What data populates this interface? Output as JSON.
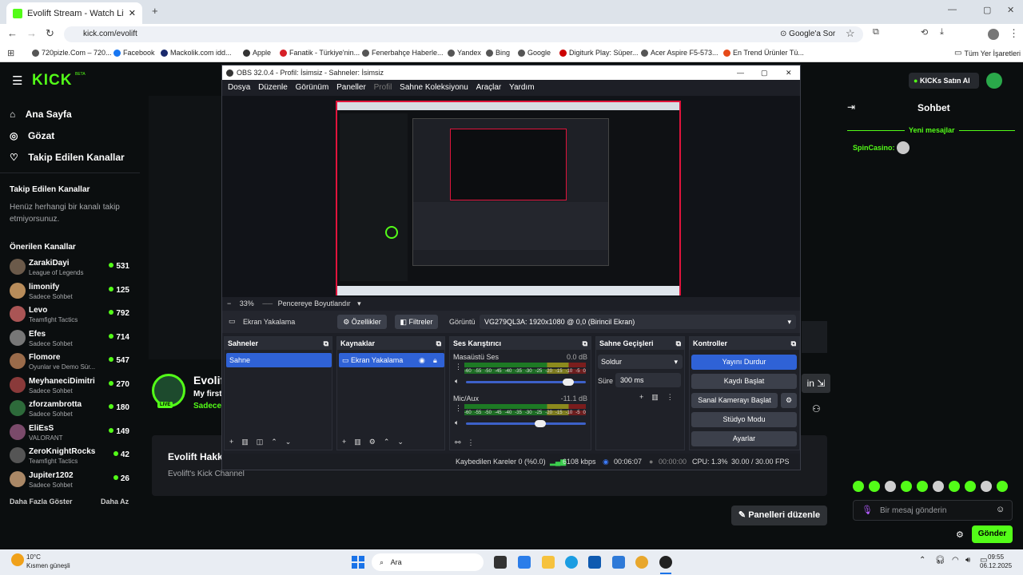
{
  "browser": {
    "tab_title": "Evolift Stream - Watch Live on K",
    "url": "kick.com/evolift",
    "google_btn": "Google'a Sor",
    "bookmarks": [
      "720pizle.Com – 720...",
      "Facebook",
      "Mackolik.com   idd...",
      "Apple",
      "Fanatik - Türkiye'nin...",
      "Fenerbahçe Haberle...",
      "Yandex",
      "Bing",
      "Google",
      "Digiturk Play: Süper...",
      "Acer Aspire F5-573...",
      "En Trend Ürünler Tü..."
    ],
    "all_bookmarks": "Tüm Yer İşaretleri"
  },
  "kick": {
    "logo": "KICK",
    "beta": "BETA",
    "nav": [
      "Ana Sayfa",
      "Gözat",
      "Takip Edilen Kanallar"
    ],
    "followed_title": "Takip Edilen Kanallar",
    "followed_empty": "Henüz herhangi bir kanalı takip etmiyorsunuz.",
    "recommended_title": "Önerilen Kanallar",
    "channels": [
      {
        "name": "ZarakiDayi",
        "game": "League of Legends",
        "viewers": "531"
      },
      {
        "name": "limonify",
        "game": "Sadece Sohbet",
        "viewers": "125"
      },
      {
        "name": "Levo",
        "game": "Teamfight Tactics",
        "viewers": "792"
      },
      {
        "name": "Efes",
        "game": "Sadece Sohbet",
        "viewers": "714"
      },
      {
        "name": "Flomore",
        "game": "Oyunlar ve Demo Sür...",
        "viewers": "547"
      },
      {
        "name": "MeyhaneciDimitri",
        "game": "Sadece Sohbet",
        "viewers": "270"
      },
      {
        "name": "zforzambrotta",
        "game": "Sadece Sohbet",
        "viewers": "180"
      },
      {
        "name": "EliEsS",
        "game": "VALORANT",
        "viewers": "149"
      },
      {
        "name": "ZeroKnightRocks",
        "game": "Teamfight Tactics",
        "viewers": "42"
      },
      {
        "name": "Jupiter1202",
        "game": "Sadece Sohbet",
        "viewers": "26"
      }
    ],
    "show_more": "Daha Fazla Göster",
    "show_less": "Daha Az",
    "kicks_btn": "KICKs Satın Al",
    "chat_title": "Sohbet",
    "new_messages": "Yeni mesajlar",
    "chat_user": "SpinCasino:",
    "streamer": "Evolift",
    "stream_title": "My first",
    "stream_game": "Sadece",
    "about_title": "Evolift Hakkı",
    "about_text": "Evolift's Kick Channel",
    "edit_panels": "Panelleri düzenle",
    "chat_placeholder": "Bir mesaj gönderin",
    "send": "Gönder"
  },
  "obs": {
    "title": "OBS 32.0.4 - Profil: İsimsiz - Sahneler: İsimsiz",
    "menu": [
      "Dosya",
      "Düzenle",
      "Görünüm",
      "Paneller",
      "Profil",
      "Sahne Koleksiyonu",
      "Araçlar",
      "Yardım"
    ],
    "zoom": "33%",
    "fit": "Pencereye Boyutlandır",
    "source_name": "Ekran Yakalama",
    "props": "Özellikler",
    "filters": "Filtreler",
    "display_label": "Görüntü",
    "display_value": "VG279QL3A: 1920x1080 @ 0,0 (Birincil Ekran)",
    "docks": {
      "scenes": "Sahneler",
      "sources": "Kaynaklar",
      "mixer": "Ses Karıştırıcı",
      "transitions": "Sahne Geçişleri",
      "controls": "Kontroller"
    },
    "scene_item": "Sahne",
    "source_item": "Ekran Yakalama",
    "audio": [
      {
        "name": "Masaüstü Ses",
        "db": "0.0 dB",
        "level": 0.85
      },
      {
        "name": "Mic/Aux",
        "db": "-11.1 dB",
        "level": 0.62
      }
    ],
    "meter_ticks": [
      "-60",
      "-55",
      "-50",
      "-45",
      "-40",
      "-35",
      "-30",
      "-25",
      "-20",
      "-15",
      "-10",
      "-5",
      "0"
    ],
    "transition": "Soldur",
    "duration_label": "Süre",
    "duration": "300 ms",
    "controls": [
      "Yayını Durdur",
      "Kaydı Başlat",
      "Sanal Kamerayı Başlat",
      "Stüdyo Modu",
      "Ayarlar"
    ],
    "status": {
      "dropped": "Kaybedilen Kareler 0 (%0.0)",
      "bitrate": "6108 kbps",
      "stream_time": "00:06:07",
      "rec_time": "00:00:00",
      "cpu": "CPU: 1.3%",
      "fps": "30.00 / 30.00 FPS"
    }
  },
  "taskbar": {
    "weather_temp": "10°C",
    "weather_desc": "Kısmen güneşli",
    "search": "Ara",
    "time": "09:55",
    "date": "06.12.2025"
  }
}
